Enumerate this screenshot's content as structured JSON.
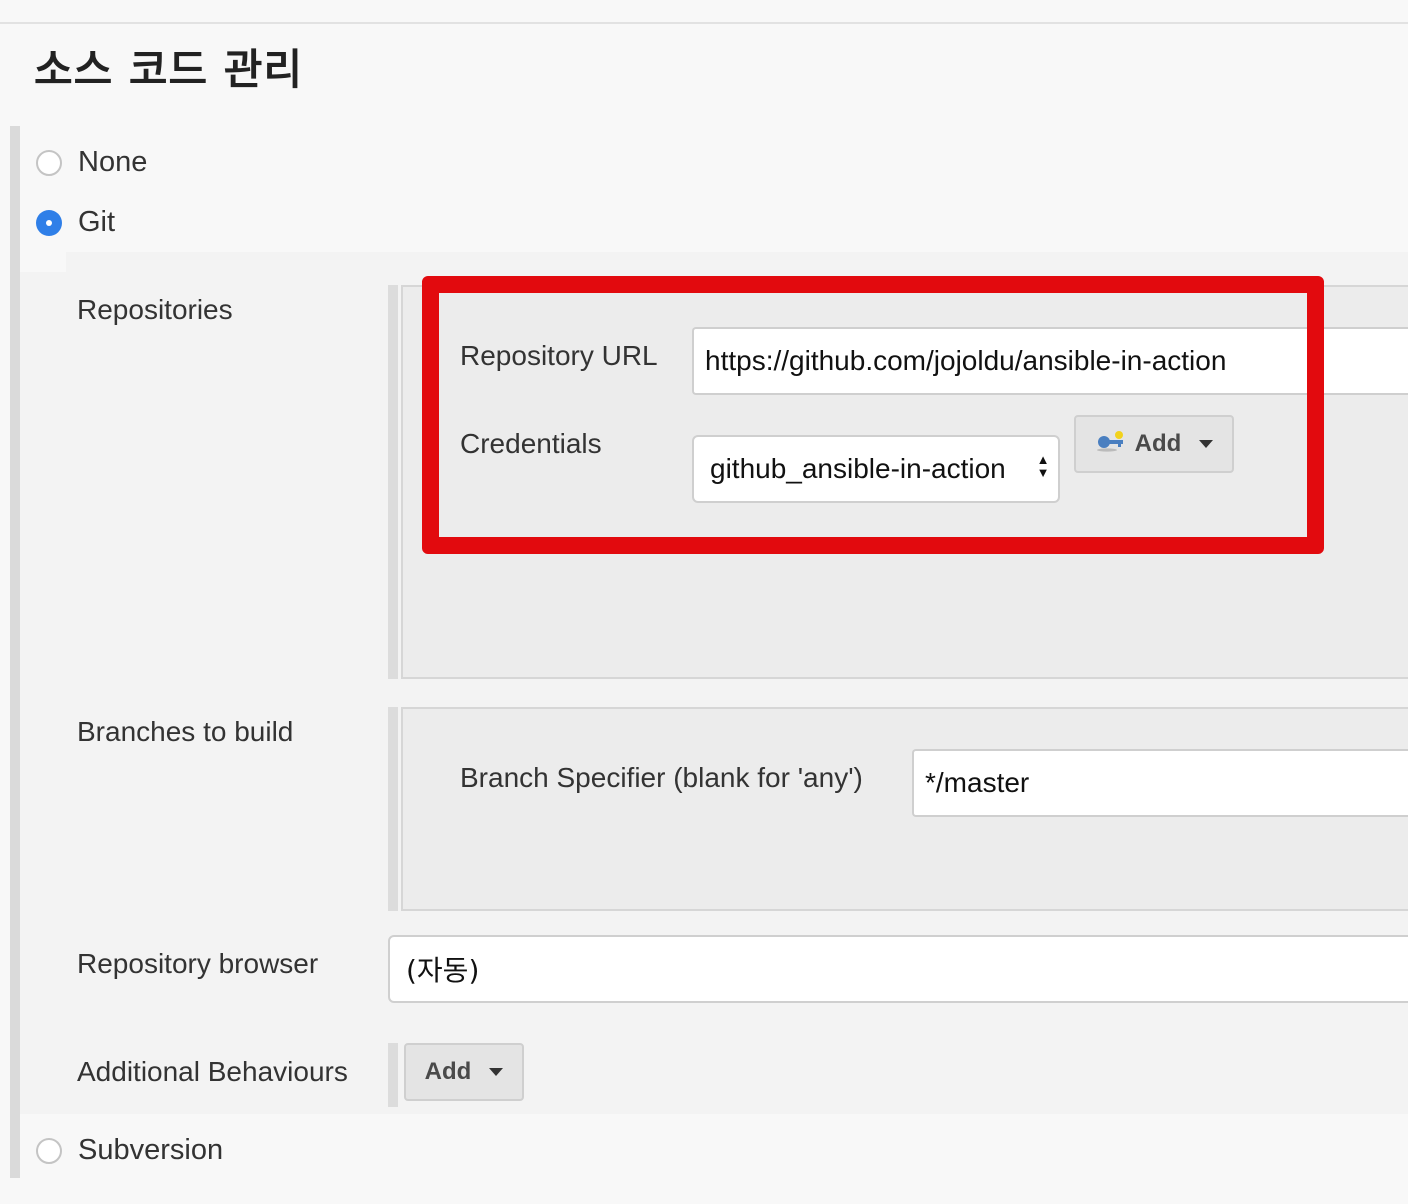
{
  "section": {
    "title": "소스 코드 관리"
  },
  "scm_options": {
    "none": "None",
    "git": "Git",
    "subversion": "Subversion",
    "selected": "Git"
  },
  "git": {
    "repositories_label": "Repositories",
    "repository_url_label": "Repository URL",
    "repository_url_value": "https://github.com/jojoldu/ansible-in-action",
    "credentials_label": "Credentials",
    "credentials_value": "github_ansible-in-action",
    "credentials_add_label": "Add",
    "branches_label": "Branches to build",
    "branch_specifier_label": "Branch Specifier (blank for 'any')",
    "branch_specifier_value": "*/master",
    "repository_browser_label": "Repository browser",
    "repository_browser_value": "(자동)",
    "additional_behaviours_label": "Additional Behaviours",
    "additional_behaviours_add_label": "Add"
  },
  "colors": {
    "highlight": "#e20a0e",
    "radio_checked": "#2f7fe8"
  },
  "icons": {
    "credentials_add": "key-icon",
    "dropdown": "caret-down-icon"
  }
}
